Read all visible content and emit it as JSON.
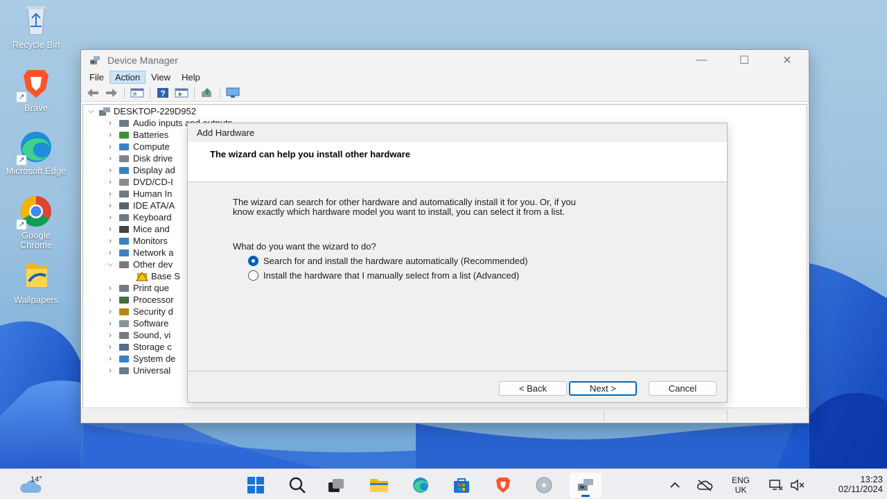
{
  "desktop": {
    "icons": [
      {
        "label": "Recycle Bin",
        "icon": "recycle-bin-icon"
      },
      {
        "label": "Brave",
        "icon": "brave-icon"
      },
      {
        "label": "Microsoft Edge",
        "icon": "edge-icon"
      },
      {
        "label": "Google Chrome",
        "icon": "chrome-icon"
      },
      {
        "label": "Wallpapers",
        "icon": "folder-icon"
      }
    ]
  },
  "device_manager": {
    "title": "Device Manager",
    "menu": [
      "File",
      "Action",
      "View",
      "Help"
    ],
    "active_menu": "Action",
    "toolbar_icons": [
      "back-arrow-icon",
      "forward-arrow-icon",
      "properties-icon",
      "help-icon",
      "view-icon",
      "update-driver-icon",
      "monitor-icon"
    ],
    "tree_root": "DESKTOP-229D952",
    "tree_items": [
      "Audio inputs and outputs",
      "Batteries",
      "Compute",
      "Disk drive",
      "Display ad",
      "DVD/CD-I",
      "Human In",
      "IDE ATA/A",
      "Keyboard",
      "Mice and",
      "Monitors",
      "Network a",
      "Other dev",
      "Base S",
      "Print que",
      "Processor",
      "Security d",
      "Software",
      "Sound, vi",
      "Storage c",
      "System de",
      "Universal"
    ]
  },
  "dialog": {
    "title": "Add Hardware",
    "heading": "The wizard can help you install other hardware",
    "body_line1": "The wizard can search for other hardware and automatically install it for you. Or, if you",
    "body_line2": "know exactly which hardware model you want to install, you can select it from a list.",
    "question": "What do you want the wizard to do?",
    "option_auto": "Search for and install the hardware automatically (Recommended)",
    "option_manual": "Install the hardware that I manually select from a list (Advanced)",
    "selected_option": "auto",
    "back_label": "< Back",
    "next_label": "Next >",
    "cancel_label": "Cancel"
  },
  "taskbar": {
    "weather_temp": "14°",
    "lang_line1": "ENG",
    "lang_line2": "UK",
    "time": "13:23",
    "date": "02/11/2024"
  },
  "colors": {
    "accent": "#005fb8",
    "menu_highlight": "#cce4f7",
    "taskbar": "#eceef1"
  }
}
